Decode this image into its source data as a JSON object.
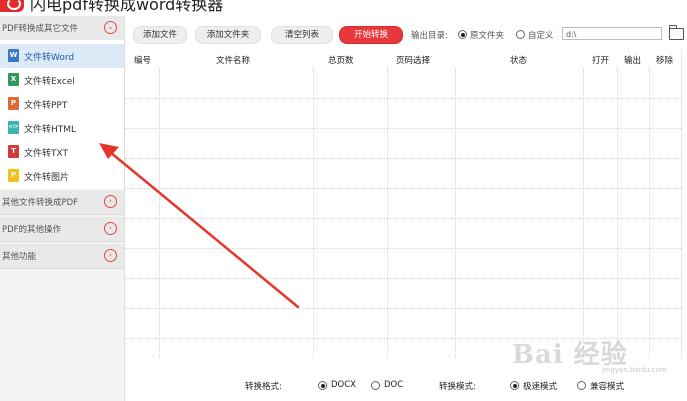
{
  "app": {
    "title": "闪电pdf转换成word转换器"
  },
  "sidebar": {
    "groups": [
      {
        "label": "PDF转换成其它文件",
        "chevron": "⌄"
      },
      {
        "label": "其他文件转换成PDF",
        "chevron": "›"
      },
      {
        "label": "PDF的其他操作",
        "chevron": "›"
      },
      {
        "label": "其他功能",
        "chevron": "›"
      }
    ],
    "items": [
      {
        "label": "文件转Word",
        "icon": "W",
        "icon_color": "#3a78c8"
      },
      {
        "label": "文件转Excel",
        "icon": "X",
        "icon_color": "#2f9a5c"
      },
      {
        "label": "文件转PPT",
        "icon": "P",
        "icon_color": "#e06a36"
      },
      {
        "label": "文件转HTML",
        "icon": "</>",
        "icon_color": "#3bb3b0"
      },
      {
        "label": "文件转TXT",
        "icon": "T",
        "icon_color": "#d33a3a"
      },
      {
        "label": "文件转图片",
        "icon": "P",
        "icon_color": "#f2c11a"
      }
    ]
  },
  "toolbar": {
    "add_file": "添加文件",
    "add_folder": "添加文件夹",
    "clear_list": "清空列表",
    "start": "开始转换",
    "output_dir_label": "输出目录:",
    "original_folder": "原文件夹",
    "custom": "自定义",
    "dir_value": "d:\\"
  },
  "table": {
    "columns": [
      "编号",
      "文件名称",
      "总页数",
      "页码选择",
      "状态",
      "打开",
      "输出",
      "移除"
    ],
    "rows": []
  },
  "bottom": {
    "format_label": "转换格式:",
    "format_options": [
      "DOCX",
      "DOC"
    ],
    "mode_label": "转换模式:",
    "mode_options": [
      "极速模式",
      "兼容模式"
    ]
  },
  "watermark": {
    "logo": "Bai 经验",
    "sub": "jingyan.baidu.com"
  },
  "colors": {
    "accent": "#e8383c",
    "selected_bg": "#dce9f7",
    "arrow": "#e8352c"
  }
}
